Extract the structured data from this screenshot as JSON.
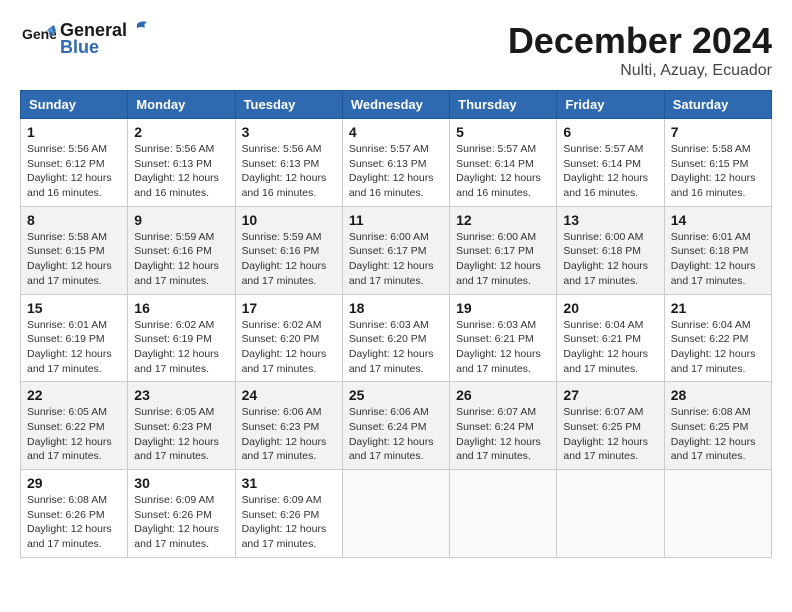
{
  "header": {
    "logo_line1": "General",
    "logo_line2": "Blue",
    "month": "December 2024",
    "location": "Nulti, Azuay, Ecuador"
  },
  "columns": [
    "Sunday",
    "Monday",
    "Tuesday",
    "Wednesday",
    "Thursday",
    "Friday",
    "Saturday"
  ],
  "weeks": [
    [
      {
        "day": "1",
        "info": "Sunrise: 5:56 AM\nSunset: 6:12 PM\nDaylight: 12 hours and 16 minutes."
      },
      {
        "day": "2",
        "info": "Sunrise: 5:56 AM\nSunset: 6:13 PM\nDaylight: 12 hours and 16 minutes."
      },
      {
        "day": "3",
        "info": "Sunrise: 5:56 AM\nSunset: 6:13 PM\nDaylight: 12 hours and 16 minutes."
      },
      {
        "day": "4",
        "info": "Sunrise: 5:57 AM\nSunset: 6:13 PM\nDaylight: 12 hours and 16 minutes."
      },
      {
        "day": "5",
        "info": "Sunrise: 5:57 AM\nSunset: 6:14 PM\nDaylight: 12 hours and 16 minutes."
      },
      {
        "day": "6",
        "info": "Sunrise: 5:57 AM\nSunset: 6:14 PM\nDaylight: 12 hours and 16 minutes."
      },
      {
        "day": "7",
        "info": "Sunrise: 5:58 AM\nSunset: 6:15 PM\nDaylight: 12 hours and 16 minutes."
      }
    ],
    [
      {
        "day": "8",
        "info": "Sunrise: 5:58 AM\nSunset: 6:15 PM\nDaylight: 12 hours and 17 minutes."
      },
      {
        "day": "9",
        "info": "Sunrise: 5:59 AM\nSunset: 6:16 PM\nDaylight: 12 hours and 17 minutes."
      },
      {
        "day": "10",
        "info": "Sunrise: 5:59 AM\nSunset: 6:16 PM\nDaylight: 12 hours and 17 minutes."
      },
      {
        "day": "11",
        "info": "Sunrise: 6:00 AM\nSunset: 6:17 PM\nDaylight: 12 hours and 17 minutes."
      },
      {
        "day": "12",
        "info": "Sunrise: 6:00 AM\nSunset: 6:17 PM\nDaylight: 12 hours and 17 minutes."
      },
      {
        "day": "13",
        "info": "Sunrise: 6:00 AM\nSunset: 6:18 PM\nDaylight: 12 hours and 17 minutes."
      },
      {
        "day": "14",
        "info": "Sunrise: 6:01 AM\nSunset: 6:18 PM\nDaylight: 12 hours and 17 minutes."
      }
    ],
    [
      {
        "day": "15",
        "info": "Sunrise: 6:01 AM\nSunset: 6:19 PM\nDaylight: 12 hours and 17 minutes."
      },
      {
        "day": "16",
        "info": "Sunrise: 6:02 AM\nSunset: 6:19 PM\nDaylight: 12 hours and 17 minutes."
      },
      {
        "day": "17",
        "info": "Sunrise: 6:02 AM\nSunset: 6:20 PM\nDaylight: 12 hours and 17 minutes."
      },
      {
        "day": "18",
        "info": "Sunrise: 6:03 AM\nSunset: 6:20 PM\nDaylight: 12 hours and 17 minutes."
      },
      {
        "day": "19",
        "info": "Sunrise: 6:03 AM\nSunset: 6:21 PM\nDaylight: 12 hours and 17 minutes."
      },
      {
        "day": "20",
        "info": "Sunrise: 6:04 AM\nSunset: 6:21 PM\nDaylight: 12 hours and 17 minutes."
      },
      {
        "day": "21",
        "info": "Sunrise: 6:04 AM\nSunset: 6:22 PM\nDaylight: 12 hours and 17 minutes."
      }
    ],
    [
      {
        "day": "22",
        "info": "Sunrise: 6:05 AM\nSunset: 6:22 PM\nDaylight: 12 hours and 17 minutes."
      },
      {
        "day": "23",
        "info": "Sunrise: 6:05 AM\nSunset: 6:23 PM\nDaylight: 12 hours and 17 minutes."
      },
      {
        "day": "24",
        "info": "Sunrise: 6:06 AM\nSunset: 6:23 PM\nDaylight: 12 hours and 17 minutes."
      },
      {
        "day": "25",
        "info": "Sunrise: 6:06 AM\nSunset: 6:24 PM\nDaylight: 12 hours and 17 minutes."
      },
      {
        "day": "26",
        "info": "Sunrise: 6:07 AM\nSunset: 6:24 PM\nDaylight: 12 hours and 17 minutes."
      },
      {
        "day": "27",
        "info": "Sunrise: 6:07 AM\nSunset: 6:25 PM\nDaylight: 12 hours and 17 minutes."
      },
      {
        "day": "28",
        "info": "Sunrise: 6:08 AM\nSunset: 6:25 PM\nDaylight: 12 hours and 17 minutes."
      }
    ],
    [
      {
        "day": "29",
        "info": "Sunrise: 6:08 AM\nSunset: 6:26 PM\nDaylight: 12 hours and 17 minutes."
      },
      {
        "day": "30",
        "info": "Sunrise: 6:09 AM\nSunset: 6:26 PM\nDaylight: 12 hours and 17 minutes."
      },
      {
        "day": "31",
        "info": "Sunrise: 6:09 AM\nSunset: 6:26 PM\nDaylight: 12 hours and 17 minutes."
      },
      null,
      null,
      null,
      null
    ]
  ]
}
